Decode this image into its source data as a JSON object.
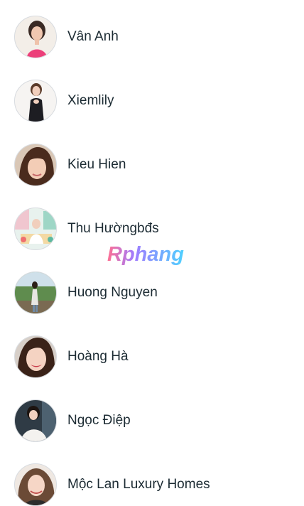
{
  "contacts": [
    {
      "name": "Vân Anh",
      "avatar_icon": "avatar-photo-woman-pink-top"
    },
    {
      "name": "Xiemlily",
      "avatar_icon": "avatar-photo-woman-black-dress"
    },
    {
      "name": "Kieu Hien",
      "avatar_icon": "avatar-photo-woman-selfie"
    },
    {
      "name": "Thu Hườngbđs",
      "avatar_icon": "avatar-photo-woman-colorful-room"
    },
    {
      "name": "Huong Nguyen",
      "avatar_icon": "avatar-photo-woman-outdoor-green"
    },
    {
      "name": "Hoàng Hà",
      "avatar_icon": "avatar-photo-woman-smiling"
    },
    {
      "name": "Ngọc Điệp",
      "avatar_icon": "avatar-photo-woman-white-jacket"
    },
    {
      "name": "Mộc Lan Luxury Homes",
      "avatar_icon": "avatar-photo-woman-wavy-hair"
    }
  ],
  "watermark": {
    "text": "Rphang"
  },
  "colors": {
    "name_text": "#1c2b33",
    "avatar_border": "#d7dbe0",
    "watermark_start": "#ff6f91",
    "watermark_end": "#4fd1ff"
  }
}
